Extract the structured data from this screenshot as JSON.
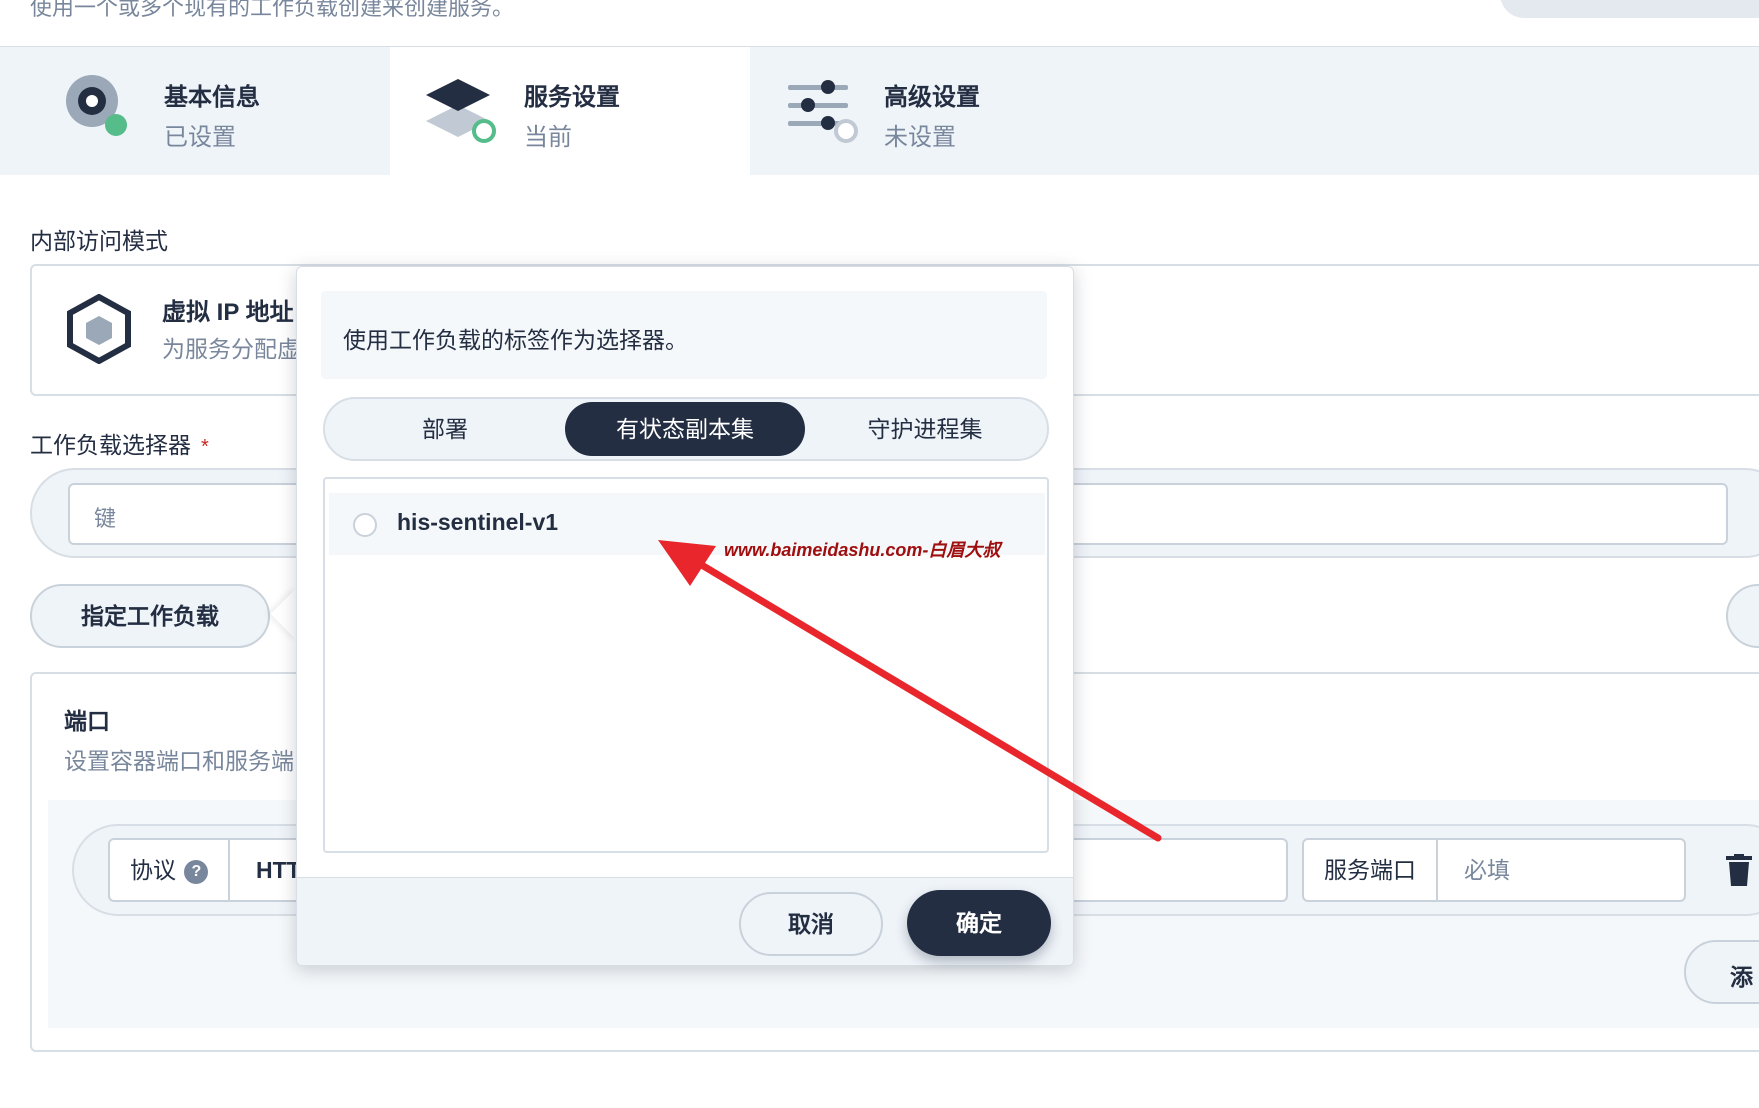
{
  "header": {
    "description": "使用一个或多个现有的工作负载创建来创建服务。"
  },
  "steps": [
    {
      "title": "基本信息",
      "status": "已设置"
    },
    {
      "title": "服务设置",
      "status": "当前"
    },
    {
      "title": "高级设置",
      "status": "未设置"
    }
  ],
  "access_mode": {
    "label": "内部访问模式",
    "option_title": "虚拟 IP 地址",
    "option_desc": "为服务分配虚"
  },
  "workload_selector": {
    "label": "工作负载选择器",
    "required_mark": "*",
    "key_placeholder": "键",
    "specify_button": "指定工作负载"
  },
  "ports": {
    "title": "端口",
    "desc": "设置容器端口和服务端",
    "protocol_label": "协议",
    "protocol_value": "HTT",
    "service_port_label": "服务端口",
    "service_port_placeholder": "必填",
    "add_button": "添"
  },
  "popover": {
    "tip": "使用工作负载的标签作为选择器。",
    "tabs": [
      "部署",
      "有状态副本集",
      "守护进程集"
    ],
    "active_tab": "有状态副本集",
    "items": [
      "his-sentinel-v1"
    ],
    "cancel_label": "取消",
    "ok_label": "确定"
  },
  "watermark": "www.baimeidashu.com-白眉大叔",
  "colors": {
    "primary_dark": "#242e42",
    "success_green": "#55bc8a",
    "annotation_red": "#e8262b",
    "required_red": "#ca2621"
  }
}
